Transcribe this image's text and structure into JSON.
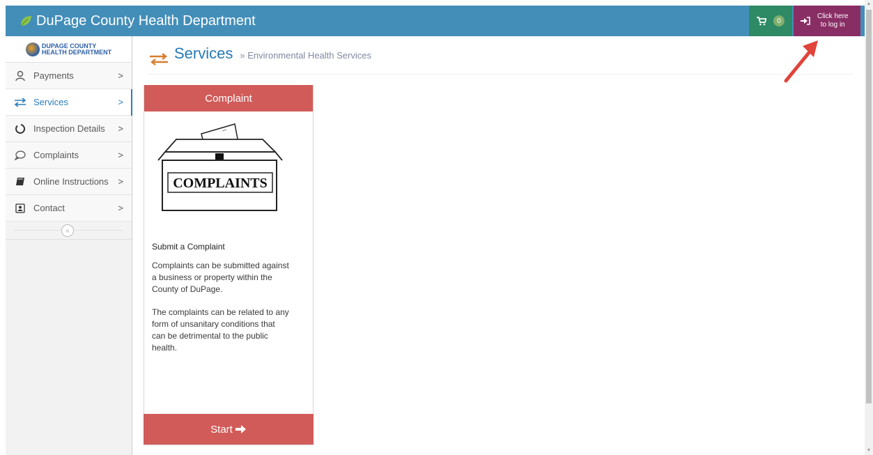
{
  "header": {
    "brand": "DuPage County Health Department",
    "cart_count": "0",
    "login_line1": "Click here",
    "login_line2": "to log in"
  },
  "sidebar": {
    "logo_line1": "DUPAGE COUNTY",
    "logo_line2": "HEALTH DEPARTMENT",
    "items": [
      {
        "label": "Payments",
        "icon": "user-icon"
      },
      {
        "label": "Services",
        "icon": "exchange-icon"
      },
      {
        "label": "Inspection Details",
        "icon": "circle-notch-icon"
      },
      {
        "label": "Complaints",
        "icon": "speech-bubble-icon"
      },
      {
        "label": "Online Instructions",
        "icon": "book-icon"
      },
      {
        "label": "Contact",
        "icon": "contact-card-icon"
      }
    ],
    "collapse_glyph": "«"
  },
  "page": {
    "title": "Services",
    "breadcrumb_sep": "»",
    "subtitle": "Environmental Health Services"
  },
  "card": {
    "header": "Complaint",
    "image_label": "COMPLAINTS",
    "title": "Submit a Complaint",
    "para1_l1": "Complaints can be submitted against",
    "para1_l2": "a business or property within the",
    "para1_l3": "County of DuPage.",
    "para2_l1": "The complaints can be related to any",
    "para2_l2": "form of unsanitary conditions that",
    "para2_l3": "can be detrimental to the public",
    "para2_l4": "health.",
    "start_label": "Start"
  },
  "colors": {
    "navbar": "#438eb9",
    "cart": "#2e8965",
    "login": "#892e65",
    "card_accent": "#d15b59",
    "active_link": "#2b7dbc",
    "annotation_arrow": "#e0443a"
  }
}
